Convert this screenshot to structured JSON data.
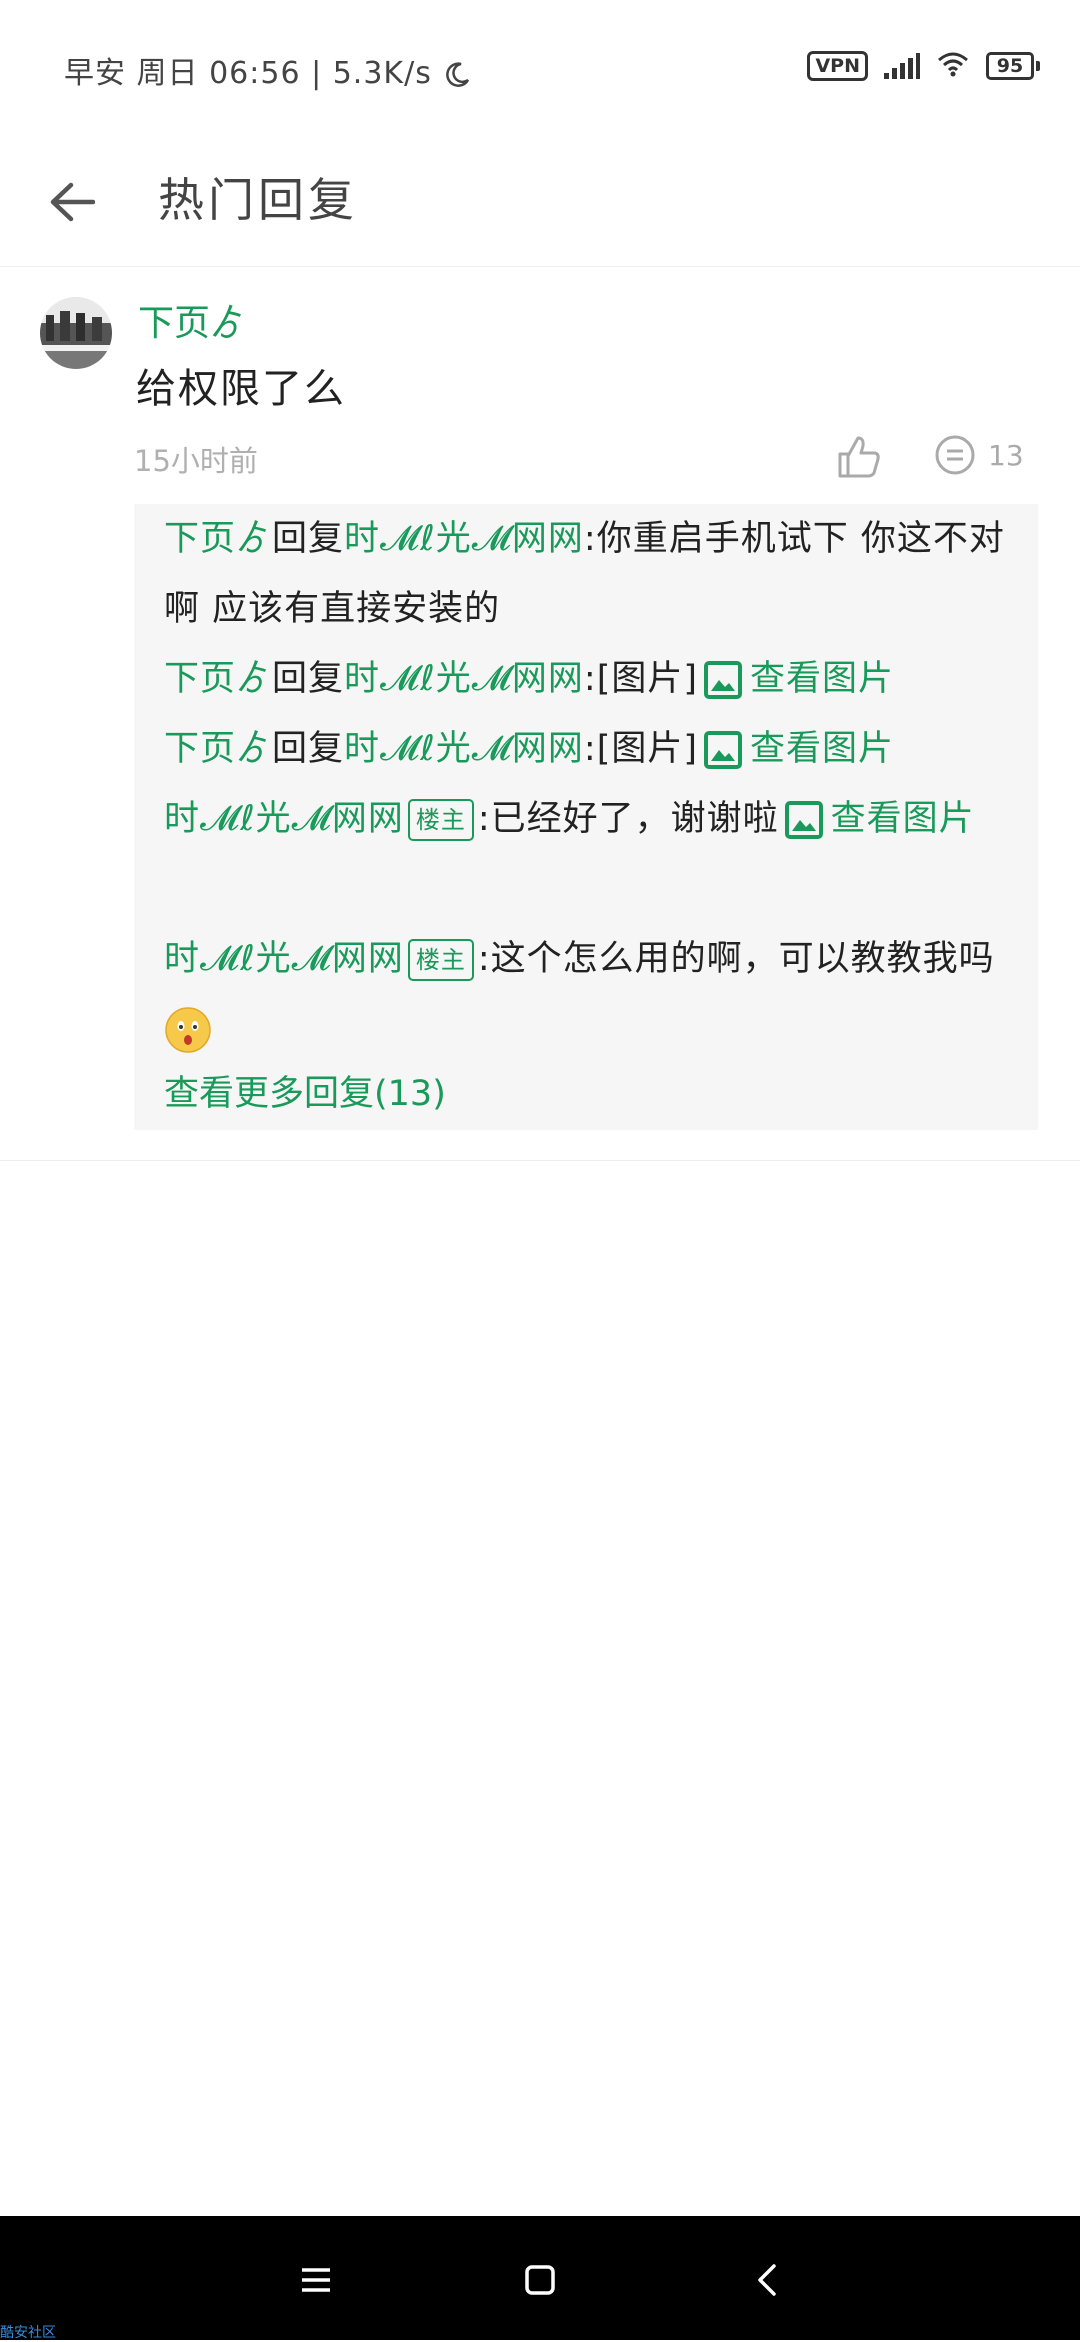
{
  "status_bar": {
    "left_text": "早安 周日 06:56 | 5.3K/s",
    "vpn": "VPN",
    "battery": "95"
  },
  "header": {
    "title": "热门回复"
  },
  "comment": {
    "author": "下页ゟ",
    "text": "给权限了么",
    "time": "15小时前",
    "reply_count": "13",
    "replies": [
      {
        "from": "下页ゟ",
        "verb": "回复",
        "to": "时𝓜ℓ光𝓜网网",
        "colon": ":",
        "content": "你重启手机试下 你这不对啊 应该有直接安装的"
      },
      {
        "from": "下页ゟ",
        "verb": "回复",
        "to": "时𝓜ℓ光𝓜网网",
        "colon": ":",
        "content": "[图片]",
        "link": "查看图片"
      },
      {
        "from": "下页ゟ",
        "verb": "回复",
        "to": "时𝓜ℓ光𝓜网网",
        "colon": ":",
        "content": "[图片]",
        "link": "查看图片"
      },
      {
        "from": "时𝓜ℓ光𝓜网网",
        "badge": "楼主",
        "colon": ":",
        "content": "已经好了，谢谢啦",
        "link": "查看图片"
      },
      {
        "from": "时𝓜ℓ光𝓜网网",
        "badge": "楼主",
        "colon": ":",
        "content": "这个怎么用的啊，可以教教我吗"
      }
    ],
    "more_replies": "查看更多回复(13)"
  },
  "watermark": "酷安社区",
  "colors": {
    "accent": "#1a9a5a",
    "nav_bar": "#000000"
  },
  "icons": [
    "back-arrow-icon",
    "thumbs-up-icon",
    "comment-icon",
    "image-icon",
    "emoji-icon",
    "menu-icon",
    "home-icon",
    "nav-back-icon",
    "moon-icon",
    "signal-icon",
    "wifi-icon",
    "battery-icon"
  ]
}
